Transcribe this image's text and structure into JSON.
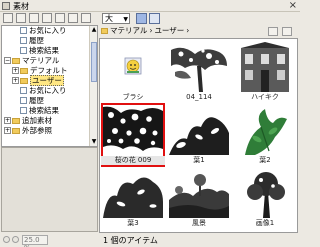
{
  "window": {
    "title": "素材"
  },
  "toolbar": {
    "size_value": "大"
  },
  "tree": {
    "items": [
      {
        "label": "お気に入り",
        "kind": "doc"
      },
      {
        "label": "履歴",
        "kind": "doc"
      },
      {
        "label": "検索結果",
        "kind": "doc"
      },
      {
        "label": "マテリアル",
        "kind": "folder",
        "expanded": true
      },
      {
        "label": "デフォルト",
        "kind": "folder"
      },
      {
        "label": "ユーザー",
        "kind": "folder",
        "selected": true
      },
      {
        "label": "お気に入り",
        "kind": "doc"
      },
      {
        "label": "履歴",
        "kind": "doc"
      },
      {
        "label": "検索結果",
        "kind": "doc"
      },
      {
        "label": "追加素材",
        "kind": "folder"
      },
      {
        "label": "外部参照",
        "kind": "folder"
      }
    ]
  },
  "zoom": {
    "value": "25.0 %"
  },
  "breadcrumb": {
    "root": "マテリアル",
    "current": "ユーザー"
  },
  "grid": {
    "items": [
      {
        "caption": "ブラシ",
        "kind": "icon"
      },
      {
        "caption": "04_114",
        "kind": "blossom"
      },
      {
        "caption": "ハイキク",
        "kind": "building"
      },
      {
        "caption": "桜の花 009",
        "kind": "sakura",
        "selected": true
      },
      {
        "caption": "葉1",
        "kind": "leaves"
      },
      {
        "caption": "葉2",
        "kind": "greenleaf"
      },
      {
        "caption": "葉3",
        "kind": "leaves2"
      },
      {
        "caption": "風景",
        "kind": "landscape"
      },
      {
        "caption": "画像1",
        "kind": "tree"
      }
    ]
  },
  "status": {
    "text": "1 個のアイテム"
  }
}
